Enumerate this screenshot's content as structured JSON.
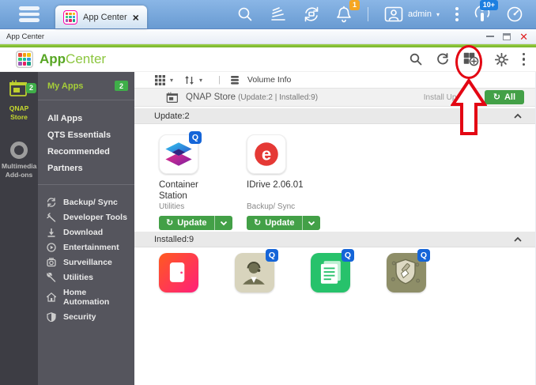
{
  "colors": {
    "accent_green": "#76b82a",
    "button_green": "#43a047",
    "annotation_red": "#e30613",
    "topbar_blue": "#79a7d9",
    "bell_badge_orange": "#f5a623",
    "info_badge_blue": "#1d7fe0"
  },
  "desktop_bar": {
    "tab_label": "App Center",
    "bell_badge": "1",
    "info_badge": "10+",
    "user_name": "admin",
    "user_caret": "▾"
  },
  "titlebar": {
    "title": "App Center"
  },
  "header": {
    "brand_bold": "App",
    "brand_light": "Center"
  },
  "rail": {
    "store_label": "QNAP Store",
    "store_badge": "2",
    "multimedia_label": "Multimedia Add-ons"
  },
  "sidebar": {
    "my_apps_label": "My Apps",
    "my_apps_badge": "2",
    "links": [
      "All Apps",
      "QTS Essentials",
      "Recommended",
      "Partners"
    ],
    "categories": [
      "Backup/ Sync",
      "Developer Tools",
      "Download",
      "Entertainment",
      "Surveillance",
      "Utilities",
      "Home Automation",
      "Security"
    ]
  },
  "toolbar": {
    "volume_info": "Volume Info",
    "caret": "▾"
  },
  "store_bar": {
    "title": "QNAP Store",
    "counts": "(Update:2 | Installed:9)",
    "install_updates_label": "Install Updates:",
    "all_button": "All",
    "refresh_glyph": "↻"
  },
  "sections": {
    "update": "Update:2",
    "installed": "Installed:9"
  },
  "update_apps": [
    {
      "name": "Container Station",
      "category": "Utilities",
      "action": "Update"
    },
    {
      "name": "IDrive 2.06.01",
      "category": "Backup/ Sync",
      "action": "Update"
    }
  ],
  "installed_apps": {
    "icons": [
      "pink-door-app-icon",
      "helpdesk-app-icon",
      "notes-app-icon",
      "malware-remover-app-icon"
    ],
    "idrive_letter": "e"
  }
}
